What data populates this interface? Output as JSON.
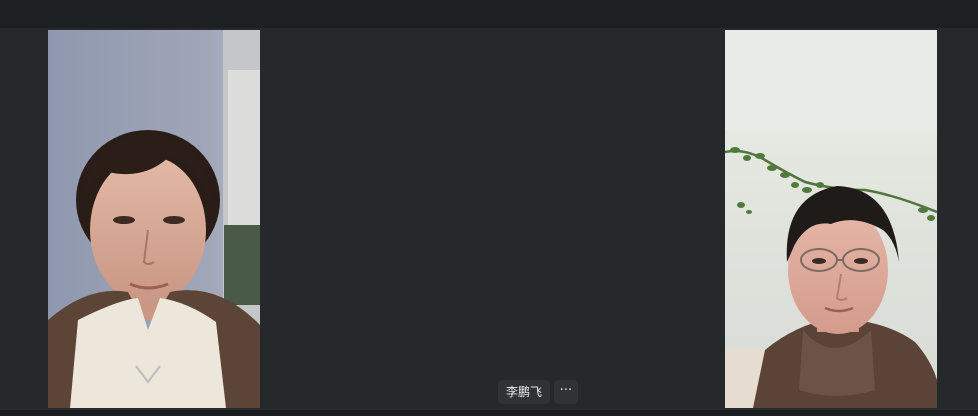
{
  "meeting": {
    "participants": [
      {
        "position": "left",
        "video": "on"
      },
      {
        "position": "right",
        "video": "on"
      }
    ],
    "active_speaker_label": "李鹏飞",
    "more_icon": "ellipsis-icon",
    "more_glyph": "···"
  },
  "colors": {
    "background": "#1c1f21",
    "stage": "#25292b",
    "label_bg": "#2f3335",
    "label_text": "#e8eaec"
  }
}
